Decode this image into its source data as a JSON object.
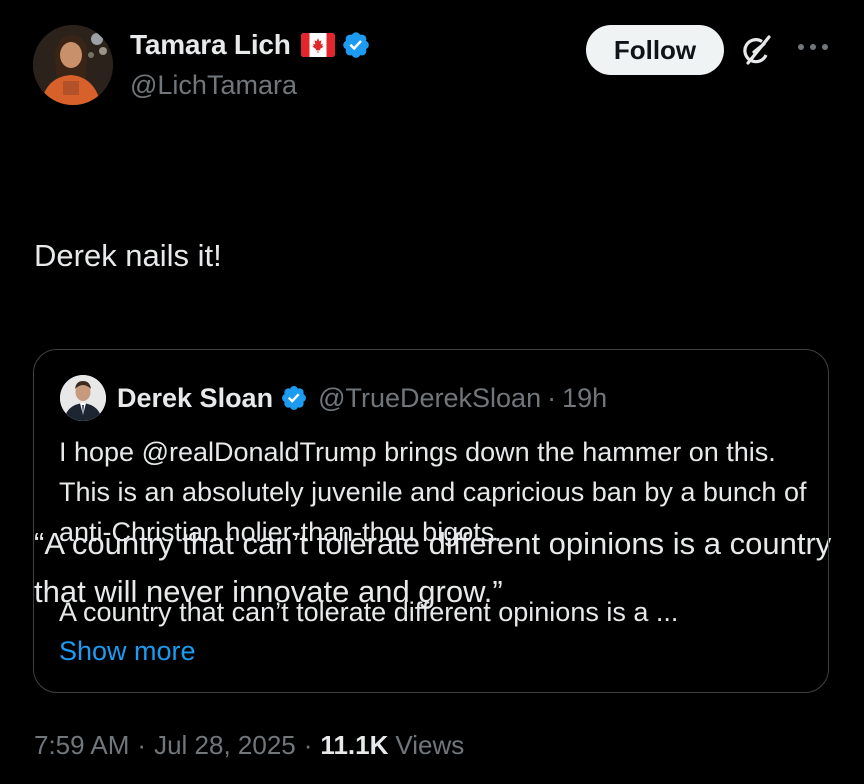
{
  "author": {
    "name": "Tamara Lich",
    "handle": "@LichTamara",
    "flag": "canada-flag",
    "verified_icon": "verified-badge-icon"
  },
  "actions": {
    "follow_label": "Follow",
    "grok_icon": "grok-icon",
    "more_icon": "more-dots-icon"
  },
  "tweet": {
    "line1": "Derek nails it!",
    "line2": "“A country that can’t tolerate different opinions is a country that will never innovate and grow.”"
  },
  "quote": {
    "name": "Derek Sloan",
    "handle": "@TrueDerekSloan",
    "dot": "·",
    "time": "19h",
    "paragraph1": "I hope @realDonaldTrump brings down the hammer on this. This is an absolutely juvenile and capricious ban by a bunch of anti-Christian holier-than-thou bigots.",
    "paragraph2": "A country that can’t tolerate different opinions is a ...",
    "show_more": "Show more"
  },
  "meta": {
    "time": "7:59 AM",
    "sep1": "·",
    "date": "Jul 28, 2025",
    "sep2": "·",
    "views_count": "11.1K",
    "views_label": "Views"
  },
  "colors": {
    "background": "#000000",
    "primary_text": "#e7e9ea",
    "secondary_text": "#71767b",
    "link": "#1d9bf0",
    "verified": "#1d9bf0",
    "follow_bg": "#eff3f4"
  }
}
